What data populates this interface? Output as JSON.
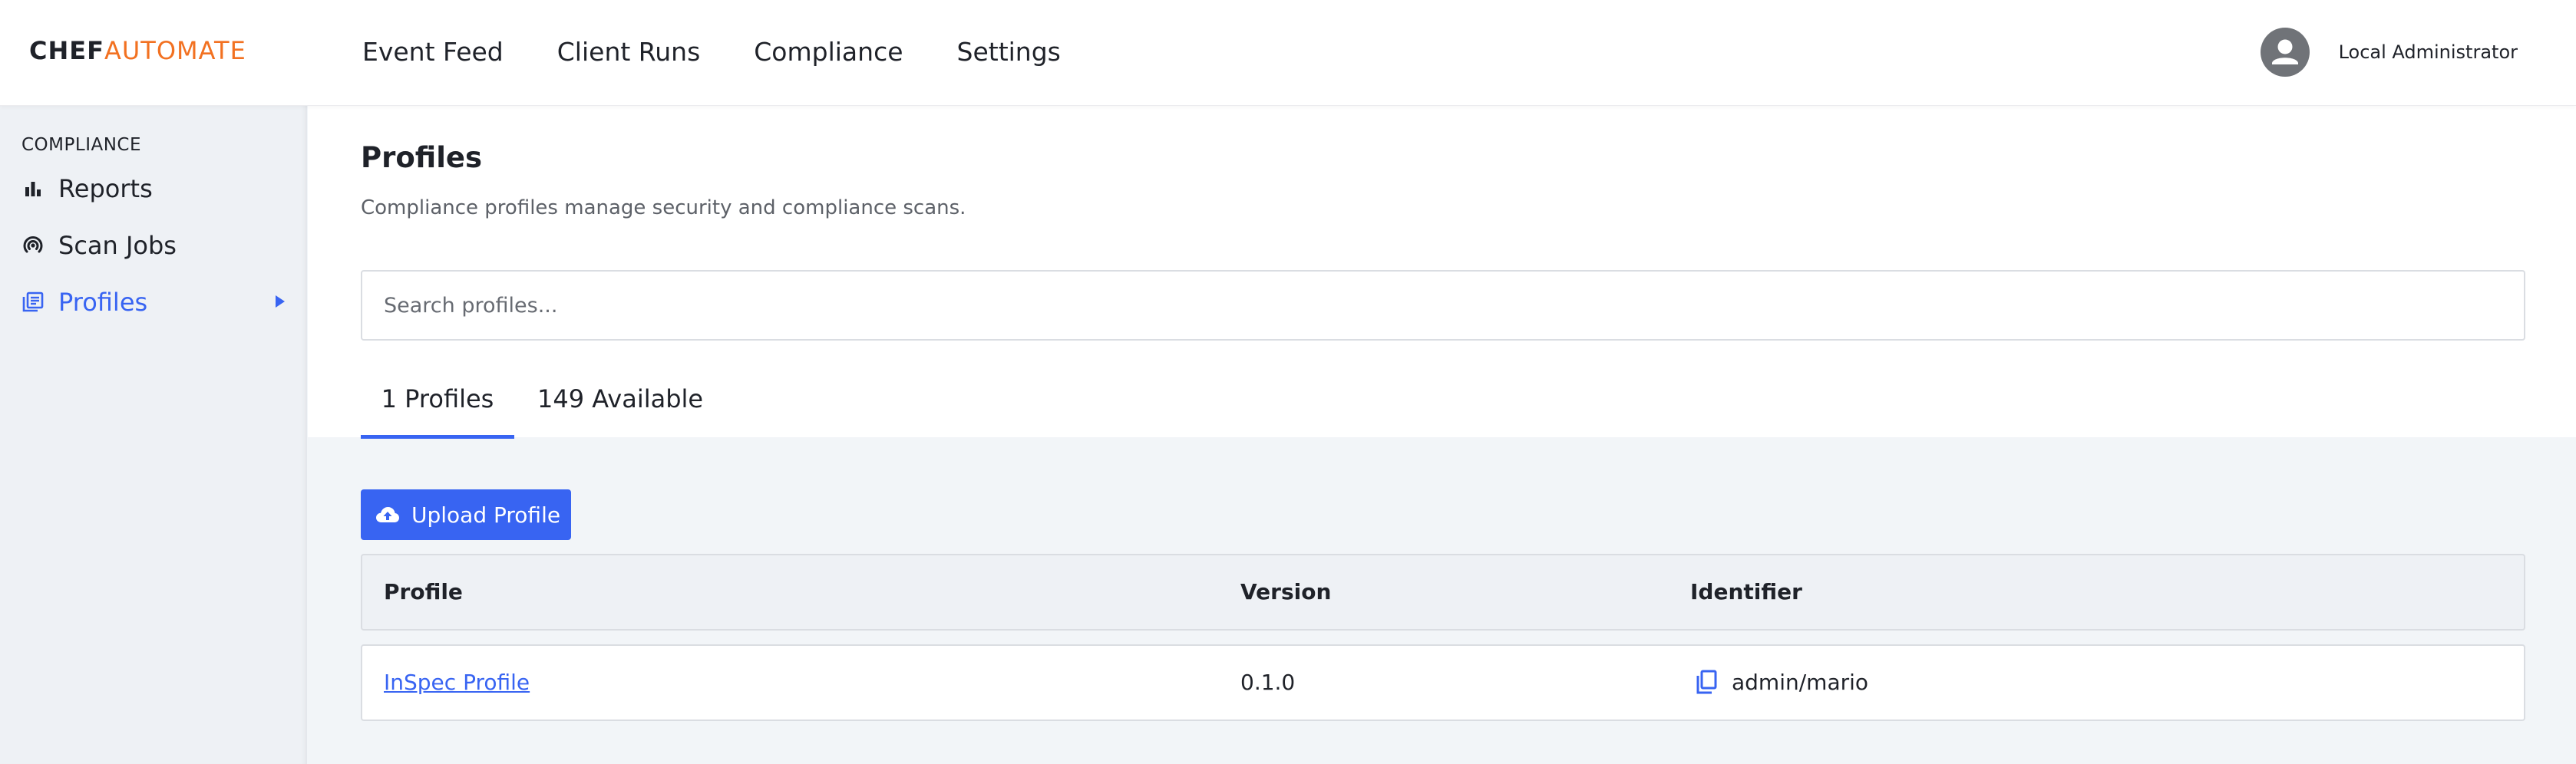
{
  "brand": {
    "part1": "CHEF",
    "part2": "AUTOMATE",
    "part1_color": "#1f2229",
    "part2_color": "#f27121"
  },
  "topnav": [
    {
      "label": "Event Feed"
    },
    {
      "label": "Client Runs"
    },
    {
      "label": "Compliance"
    },
    {
      "label": "Settings"
    }
  ],
  "user": {
    "name": "Local Administrator",
    "icon": "user-avatar-icon"
  },
  "sidebar": {
    "heading": "COMPLIANCE",
    "items": [
      {
        "label": "Reports",
        "icon": "bar-chart-icon",
        "active": false
      },
      {
        "label": "Scan Jobs",
        "icon": "radar-icon",
        "active": false
      },
      {
        "label": "Profiles",
        "icon": "library-books-icon",
        "active": true
      }
    ]
  },
  "page": {
    "title": "Profiles",
    "subtitle": "Compliance profiles manage security and compliance scans."
  },
  "search": {
    "placeholder": "Search profiles...",
    "value": ""
  },
  "tabs": [
    {
      "label": "1 Profiles",
      "active": true
    },
    {
      "label": "149 Available",
      "active": false
    }
  ],
  "upload_button": {
    "label": "Upload Profile",
    "icon": "cloud-upload-icon"
  },
  "table": {
    "columns": [
      "Profile",
      "Version",
      "Identifier"
    ],
    "rows": [
      {
        "profile": "InSpec Profile",
        "version": "0.1.0",
        "identifier": "admin/mario"
      }
    ]
  },
  "colors": {
    "accent": "#3864f2",
    "sidebar_bg": "#eef1f5",
    "page_bg": "#f2f5f8"
  }
}
